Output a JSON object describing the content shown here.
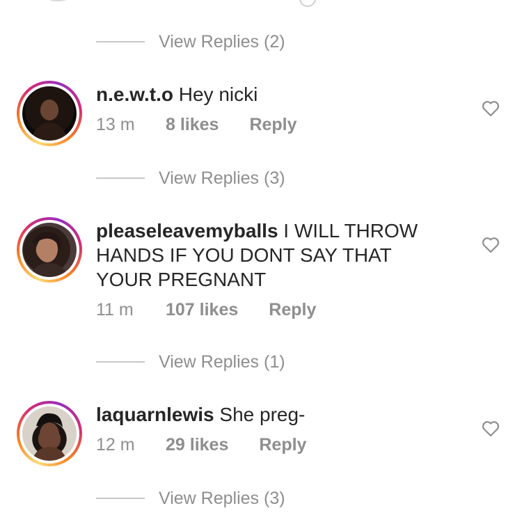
{
  "comments": [
    {
      "username": "n.e.w.t.o",
      "text": "Hey nicki",
      "time": "13 m",
      "likes": "8 likes",
      "reply": "Reply",
      "avatar_icon": "user-avatar"
    },
    {
      "username": "pleaseleavemyballs",
      "text": "I WILL THROW HANDS IF YOU DONT SAY THAT YOUR PREGNANT",
      "time": "11 m",
      "likes": "107 likes",
      "reply": "Reply",
      "avatar_icon": "user-avatar"
    },
    {
      "username": "laquarnlewis",
      "text": "She preg-",
      "time": "12 m",
      "likes": "29 likes",
      "reply": "Reply",
      "avatar_icon": "user-avatar"
    }
  ],
  "view_replies": [
    "View Replies (2)",
    "View Replies (3)",
    "View Replies (1)",
    "View Replies (3)"
  ],
  "icons": {
    "like": "heart-outline-icon"
  },
  "colors": {
    "text_primary": "#262626",
    "text_secondary": "#8e8e8e",
    "story_ring": [
      "#feda75",
      "#fa7e1e",
      "#d62976",
      "#962fbf"
    ]
  }
}
